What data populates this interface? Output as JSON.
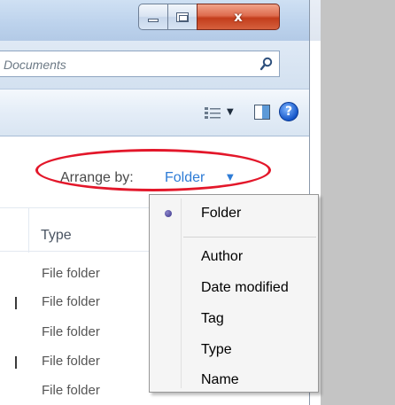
{
  "window": {
    "caption": {
      "minimize_glyph": "minimize-icon",
      "maximize_glyph": "maximize-icon",
      "close_glyph": "x"
    }
  },
  "address": {
    "search_text": "Documents"
  },
  "toolbar": {
    "views_icon": "views-icon",
    "preview_icon": "preview-pane-icon",
    "help_icon": "?"
  },
  "arrange": {
    "label": "Arrange by:",
    "value": "Folder",
    "arrow": "▼"
  },
  "columns": {
    "type": "Type"
  },
  "rows": [
    {
      "type": "File folder"
    },
    {
      "type": "File folder"
    },
    {
      "type": "File folder"
    },
    {
      "type": "File folder"
    },
    {
      "type": "File folder"
    }
  ],
  "menu": {
    "selected": "Folder",
    "items": [
      {
        "label": "Folder"
      },
      {
        "label": "Author"
      },
      {
        "label": "Date modified"
      },
      {
        "label": "Tag"
      },
      {
        "label": "Type"
      },
      {
        "label": "Name"
      }
    ]
  },
  "colors": {
    "highlight": "#e3172a",
    "link": "#2e7cd6",
    "close_button": "#c33d1c"
  }
}
